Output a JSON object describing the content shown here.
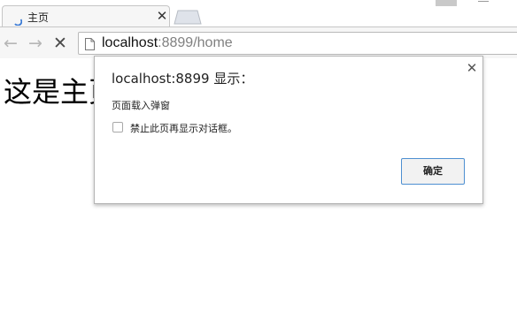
{
  "browser": {
    "tab": {
      "title": "主页",
      "close_icon": "close-icon",
      "loading_icon": "spinner-icon"
    },
    "toolbar": {
      "back_icon": "back-arrow-icon",
      "forward_icon": "forward-arrow-icon",
      "stop_icon": "stop-icon",
      "address": {
        "host": "localhost",
        "port_path": ":8899/home"
      }
    }
  },
  "page": {
    "heading": "这是主页"
  },
  "dialog": {
    "title": "localhost:8899 显示：",
    "message": "页面载入弹窗",
    "checkbox_label": "禁止此页再显示对话框。",
    "checkbox_checked": false,
    "ok_label": "确定",
    "accent_color": "#4d8fd1"
  }
}
